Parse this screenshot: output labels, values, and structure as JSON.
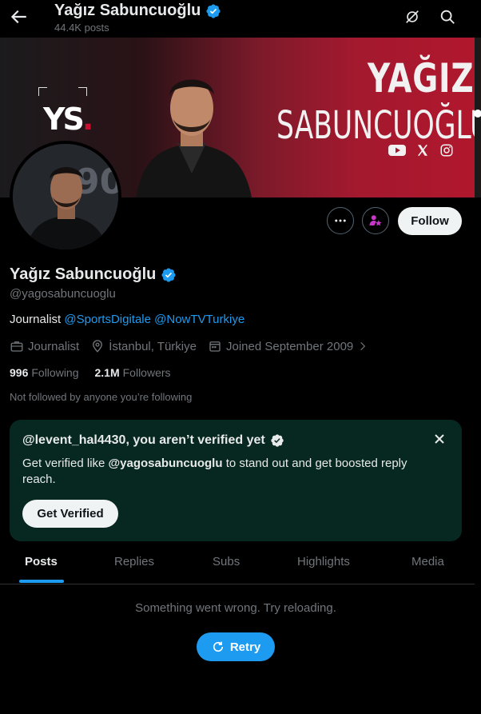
{
  "header": {
    "title": "Yağız Sabuncuoğlu",
    "posts_count": "44.4K posts"
  },
  "banner": {
    "logo_text": "YS",
    "name_line1": "YAĞIZ",
    "name_line2": "SABUNCUOĞLU",
    "social_icons": [
      "youtube-icon",
      "x-icon",
      "instagram-icon"
    ]
  },
  "actions": {
    "follow_label": "Follow"
  },
  "profile": {
    "display_name": "Yağız Sabuncuoğlu",
    "handle": "@yagosabuncuoglu",
    "bio_prefix": "Journalist",
    "bio_link1": "@SportsDigitale",
    "bio_link2": "@NowTVTurkiye",
    "category": "Journalist",
    "location": "İstanbul, Türkiye",
    "joined": "Joined September 2009",
    "following_count": "996",
    "following_label": "Following",
    "followers_count": "2.1M",
    "followers_label": "Followers",
    "not_followed_text": "Not followed by anyone you’re following"
  },
  "verify_card": {
    "title": "@levent_hal4430, you aren’t verified yet",
    "text_prefix": "Get verified like",
    "text_handle": "@yagosabuncuoglu",
    "text_suffix": "to stand out and get boosted reply reach.",
    "button_label": "Get Verified"
  },
  "tabs": [
    {
      "label": "Posts",
      "active": true
    },
    {
      "label": "Replies",
      "active": false
    },
    {
      "label": "Subs",
      "active": false
    },
    {
      "label": "Highlights",
      "active": false
    },
    {
      "label": "Media",
      "active": false
    }
  ],
  "feed": {
    "error_text": "Something went wrong. Try reloading.",
    "retry_label": "Retry"
  },
  "colors": {
    "accent": "#1d9bf0",
    "card_bg": "#072820",
    "subscribe_icon": "#c936c9"
  }
}
